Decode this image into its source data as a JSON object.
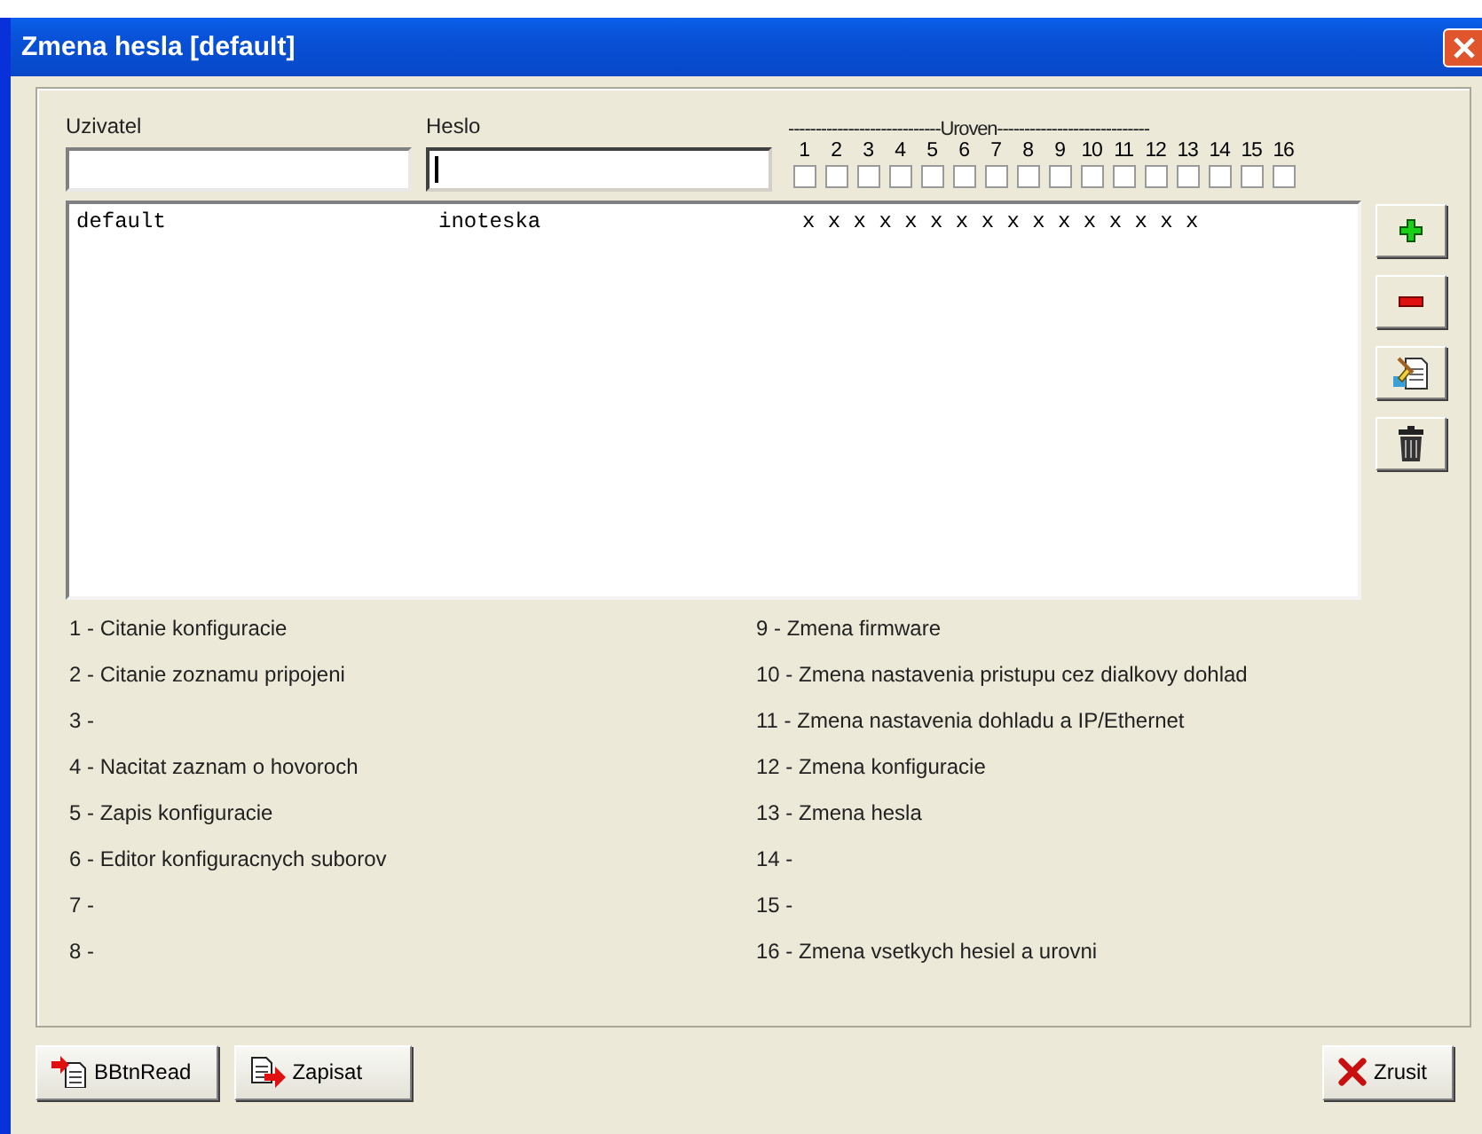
{
  "window": {
    "title": "Zmena hesla [default]"
  },
  "fields": [
    {
      "label": "Uzivatel",
      "focused": false
    },
    {
      "label": "Heslo",
      "focused": true
    }
  ],
  "levels": {
    "header": "----------------------------Uroven----------------------------",
    "items": [
      {
        "label": "1",
        "checked": false
      },
      {
        "label": "2",
        "checked": false
      },
      {
        "label": "3",
        "checked": false
      },
      {
        "label": "4",
        "checked": false
      },
      {
        "label": "5",
        "checked": false
      },
      {
        "label": "6",
        "checked": false
      },
      {
        "label": "7",
        "checked": false
      },
      {
        "label": "8",
        "checked": false
      },
      {
        "label": "9",
        "checked": false
      },
      {
        "label": "10",
        "checked": false
      },
      {
        "label": "11",
        "checked": false
      },
      {
        "label": "12",
        "checked": false
      },
      {
        "label": "13",
        "checked": false
      },
      {
        "label": "14",
        "checked": false
      },
      {
        "label": "15",
        "checked": false
      },
      {
        "label": "16",
        "checked": false
      }
    ]
  },
  "users": [
    {
      "user": "default",
      "password": "inoteska",
      "levels": "x x x x x x x x x x x x x x x x",
      "selected": false
    }
  ],
  "side_buttons": [
    {
      "kind": "add"
    },
    {
      "kind": "remove"
    },
    {
      "kind": "edit"
    },
    {
      "kind": "delete"
    }
  ],
  "legend_left": [
    "1 - Citanie konfiguracie",
    "2 - Citanie zoznamu pripojeni",
    "3 -",
    "4 - Nacitat zaznam o hovoroch",
    "5 - Zapis konfiguracie",
    "6 - Editor konfiguracnych suborov",
    "7 -",
    "8 -"
  ],
  "legend_right": [
    "9 - Zmena firmware",
    "10 - Zmena nastavenia pristupu cez dialkovy dohlad",
    "11 - Zmena nastavenia dohladu a IP/Ethernet",
    "12 - Zmena konfiguracie",
    "13 - Zmena hesla",
    "14 -",
    "15 -",
    "16 - Zmena vsetkych hesiel a urovni"
  ],
  "buttons": [
    {
      "kind": "read",
      "label": "BBtnRead"
    },
    {
      "kind": "write",
      "label": "Zapisat"
    },
    {
      "kind": "cancel",
      "label": "Zrusit"
    }
  ]
}
